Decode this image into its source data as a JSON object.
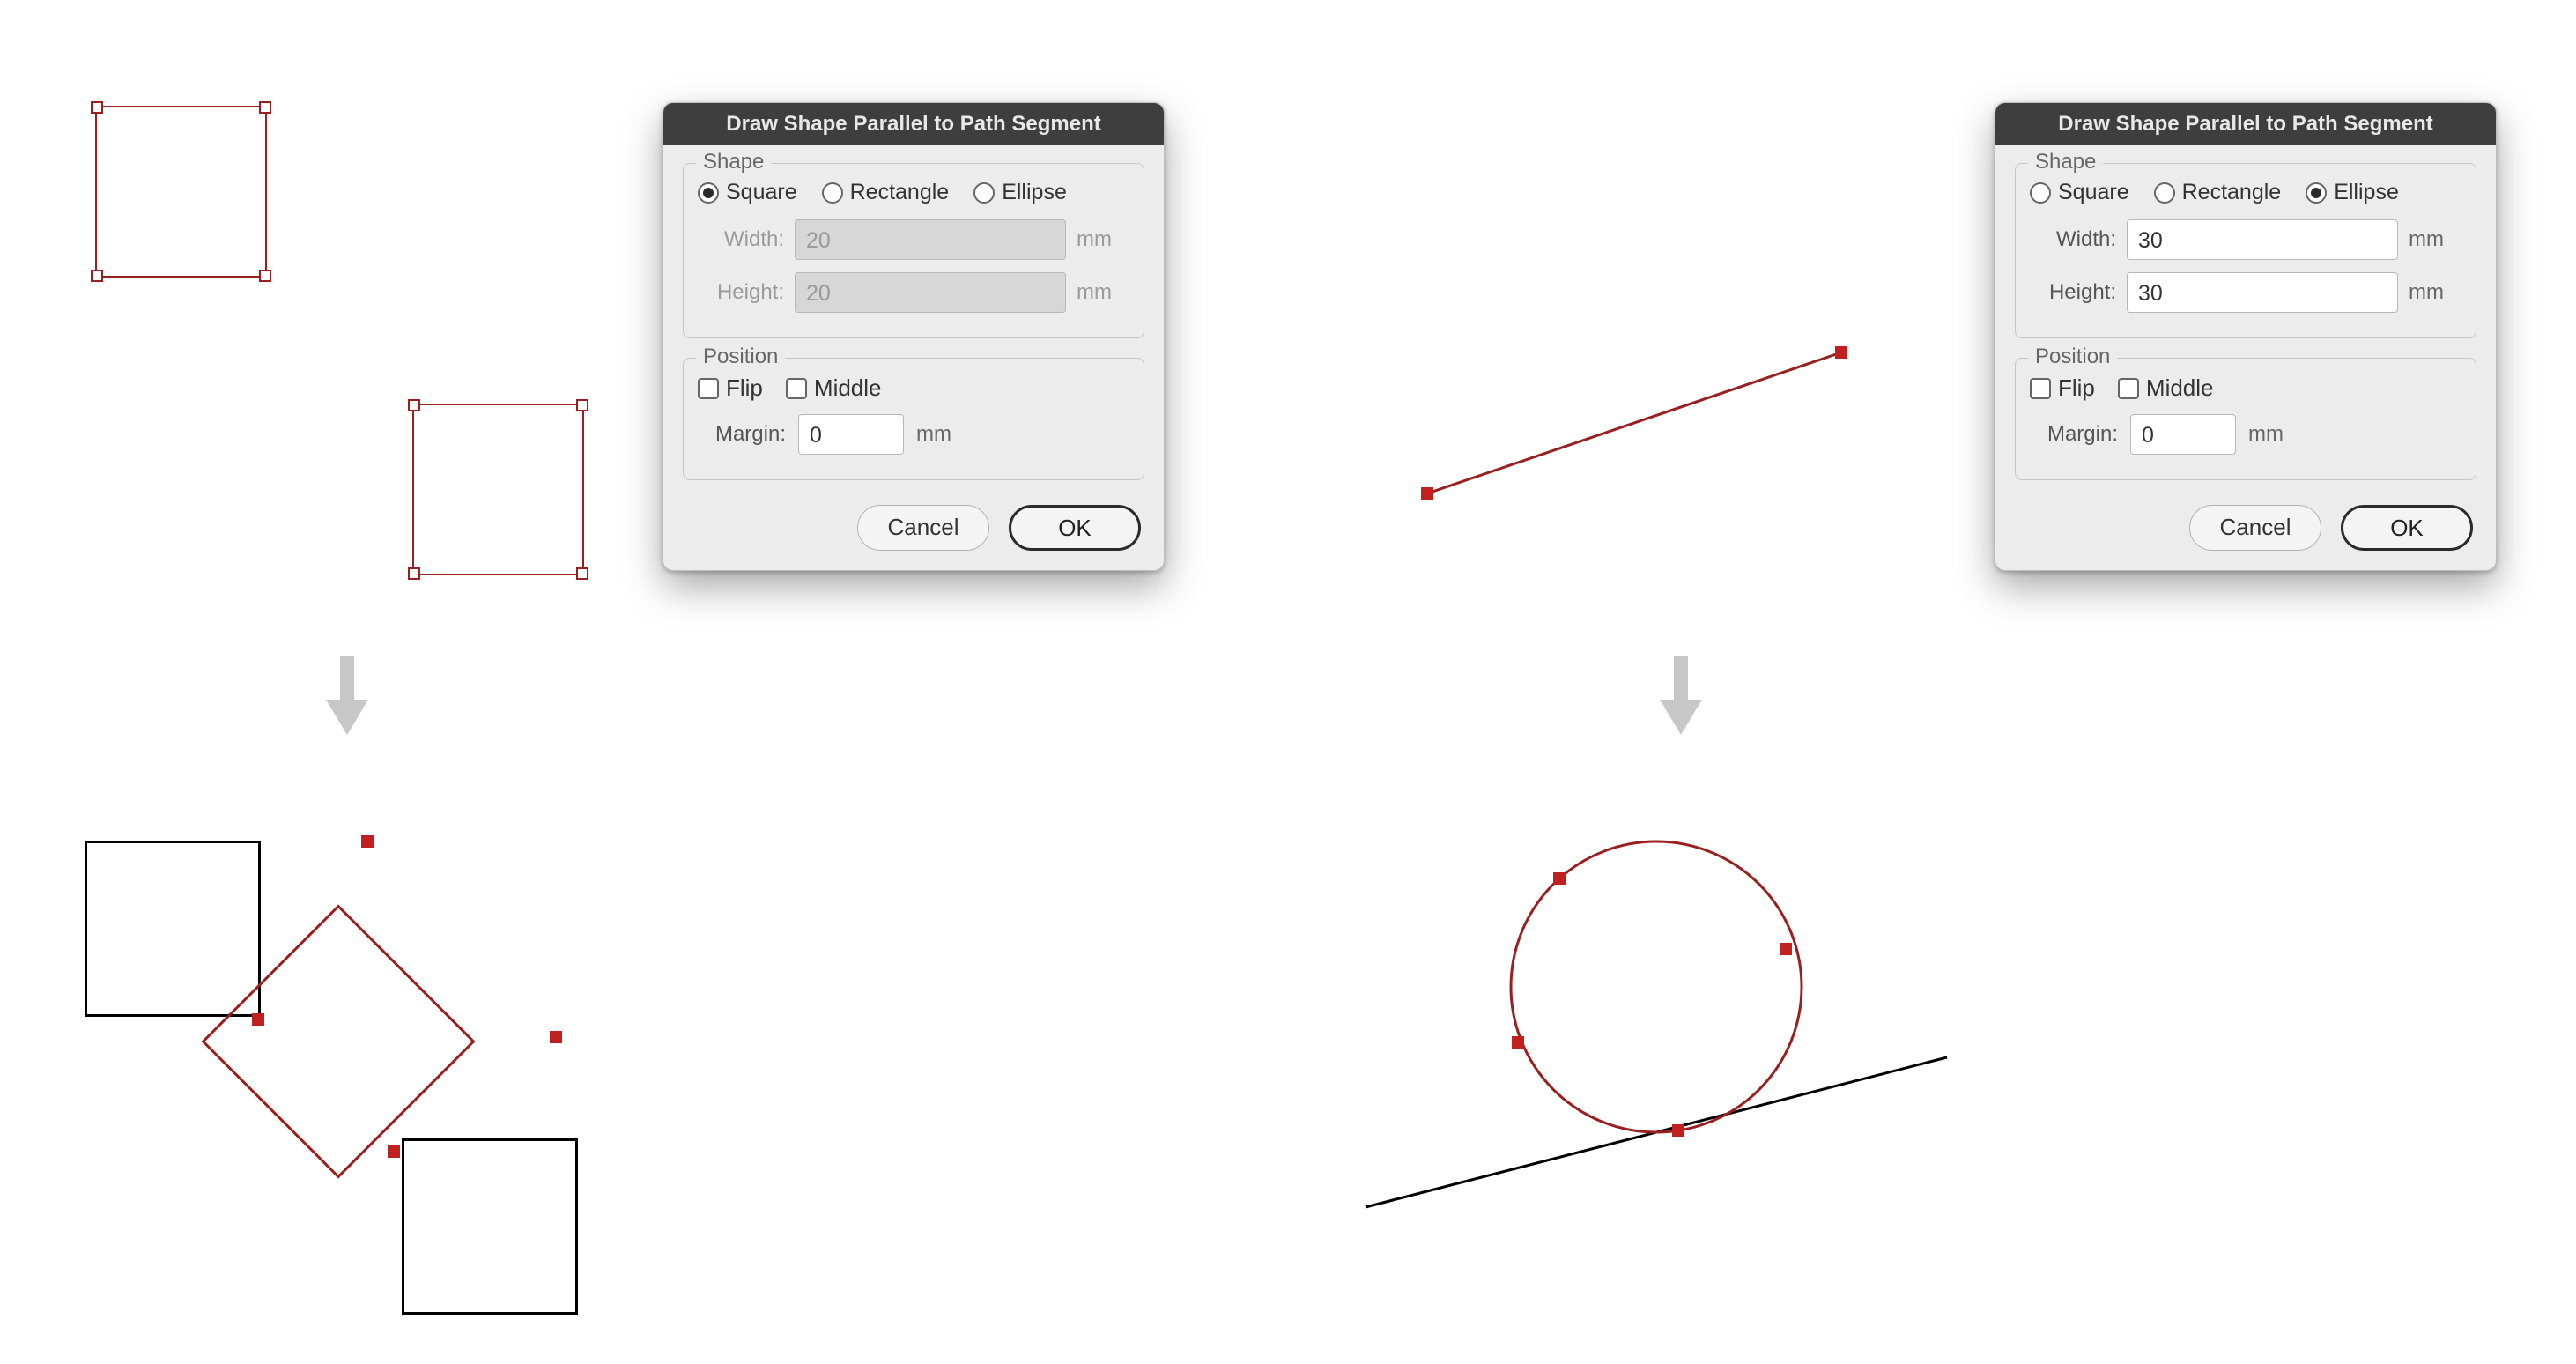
{
  "dialogs": {
    "left": {
      "title": "Draw Shape Parallel to Path Segment",
      "shape": {
        "label": "Shape",
        "opts": {
          "square": "Square",
          "rectangle": "Rectangle",
          "ellipse": "Ellipse"
        },
        "selected": "square",
        "width_label": "Width:",
        "width_value": "20",
        "height_label": "Height:",
        "height_value": "20",
        "unit": "mm",
        "dims_enabled": false
      },
      "position": {
        "label": "Position",
        "flip": "Flip",
        "middle": "Middle",
        "margin_label": "Margin:",
        "margin_value": "0",
        "unit": "mm"
      },
      "buttons": {
        "cancel": "Cancel",
        "ok": "OK"
      }
    },
    "right": {
      "title": "Draw Shape Parallel to Path Segment",
      "shape": {
        "label": "Shape",
        "opts": {
          "square": "Square",
          "rectangle": "Rectangle",
          "ellipse": "Ellipse"
        },
        "selected": "ellipse",
        "width_label": "Width:",
        "width_value": "30",
        "height_label": "Height:",
        "height_value": "30",
        "unit": "mm",
        "dims_enabled": true
      },
      "position": {
        "label": "Position",
        "flip": "Flip",
        "middle": "Middle",
        "margin_label": "Margin:",
        "margin_value": "0",
        "unit": "mm"
      },
      "buttons": {
        "cancel": "Cancel",
        "ok": "OK"
      }
    }
  }
}
